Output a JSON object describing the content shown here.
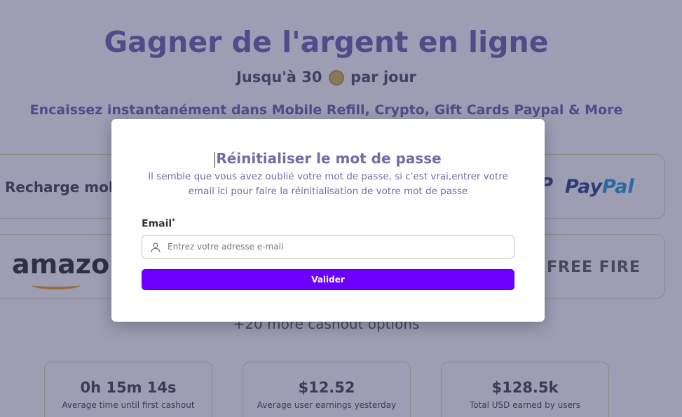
{
  "hero": {
    "title": "Gagner de l'argent en ligne",
    "subtitle_prefix": "Jusqu'à 30",
    "subtitle_suffix": "par jour",
    "description": "Encaissez instantanément dans Mobile Refill, Crypto, Gift Cards Paypal & More"
  },
  "cards": {
    "recharge": "Recharge mob",
    "paypal_mark": "P",
    "paypal_pay": "Pay",
    "paypal_pal": "Pal",
    "amazon": "amazo",
    "freefire": "FREE FIRE"
  },
  "more_options": "+20 more cashout options",
  "stats": [
    {
      "value": "0h 15m 14s",
      "label": "Average time until first cashout"
    },
    {
      "value": "$12.52",
      "label": "Average user earnings yesterday"
    },
    {
      "value": "$128.5k",
      "label": "Total USD earned by users"
    }
  ],
  "modal": {
    "title": "Réinitialiser le mot de passe",
    "description": "Il semble que vous avez oublié votre mot de passe, si c'est vrai,entrer votre email ici pour faire la réinitialisation de votre mot de passe",
    "email_label": "Email",
    "required_mark": "*",
    "email_placeholder": "Entrez votre adresse e-mail",
    "email_value": "",
    "submit_label": "Valider"
  },
  "icons": {
    "coin": "coin-icon",
    "user": "user-icon"
  },
  "colors": {
    "accent": "#6e00ff",
    "title_purple": "#6b5aa8",
    "modal_text": "#6f6ca8",
    "overlay": "rgba(60,60,105,0.5)"
  }
}
